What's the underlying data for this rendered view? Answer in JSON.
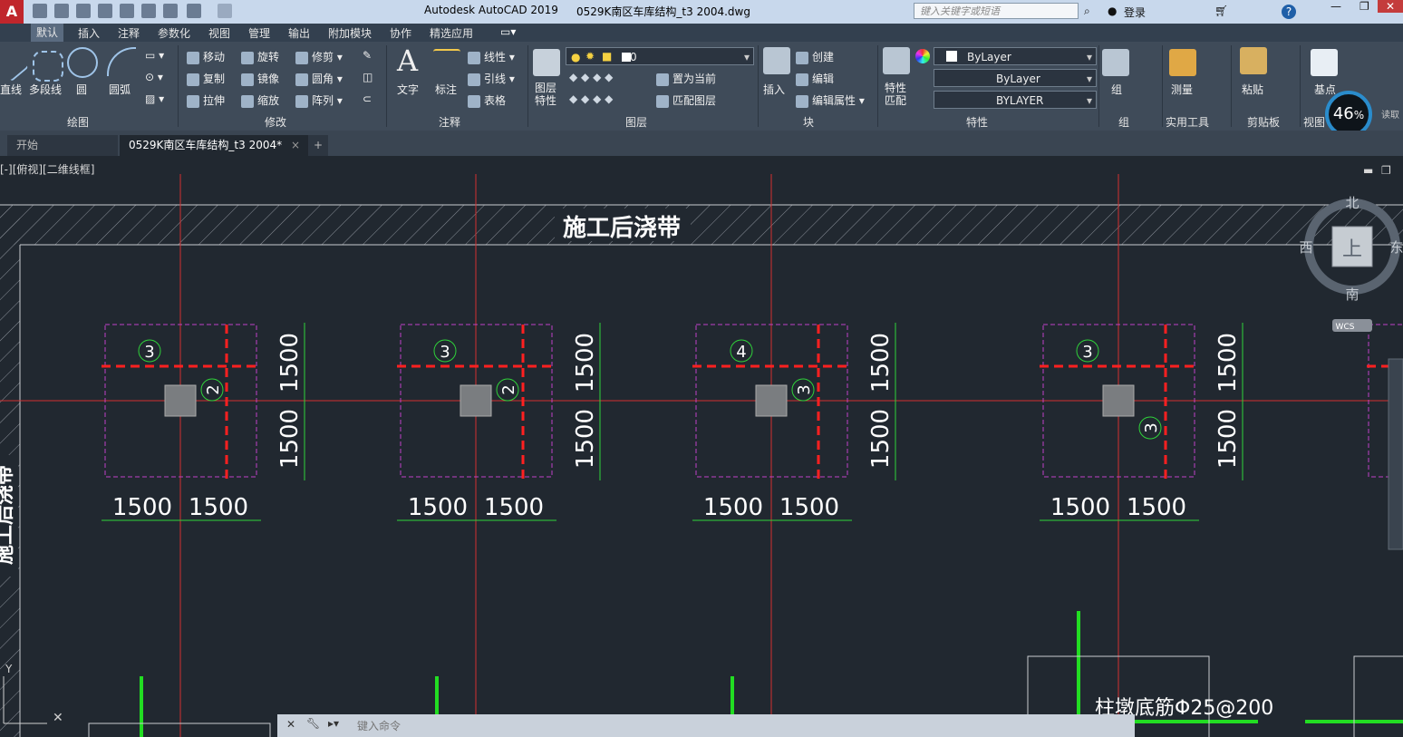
{
  "titlebar": {
    "app_title": "Autodesk AutoCAD 2019",
    "file_title": "0529K南区车库结构_t3 2004.dwg",
    "search_placeholder": "键入关键字或短语",
    "login": "登录",
    "help": "?"
  },
  "ribbon_tabs": [
    "默认",
    "插入",
    "注释",
    "参数化",
    "视图",
    "管理",
    "输出",
    "附加模块",
    "协作",
    "精选应用"
  ],
  "ribbon": {
    "draw": {
      "title": "绘图",
      "line": "直线",
      "polyline": "多段线",
      "circle": "圆",
      "arc": "圆弧"
    },
    "modify": {
      "title": "修改",
      "move": "移动",
      "rotate": "旋转",
      "trim": "修剪",
      "copy": "复制",
      "mirror": "镜像",
      "fillet": "圆角",
      "stretch": "拉伸",
      "scale": "缩放",
      "array": "阵列"
    },
    "annotation": {
      "title": "注释",
      "text": "文字",
      "dimension": "标注",
      "linear": "线性",
      "leader": "引线",
      "table": "表格"
    },
    "layers": {
      "title": "图层",
      "layer_props": "图层特性",
      "current_layer": "0",
      "set_current": "置为当前",
      "match_layer": "匹配图层"
    },
    "block": {
      "title": "块",
      "insert": "插入",
      "create": "创建",
      "edit": "编辑",
      "edit_attr": "编辑属性"
    },
    "properties": {
      "title": "特性",
      "match": "特性匹配",
      "color": "ByLayer",
      "linetype": "ByLayer",
      "lineweight": "BYLAYER"
    },
    "groups": {
      "title": "组",
      "group": "组"
    },
    "utilities": {
      "title": "实用工具",
      "measure": "测量"
    },
    "clipboard": {
      "title": "剪贴板",
      "paste": "粘贴"
    },
    "view": {
      "title": "视图",
      "base": "基点"
    }
  },
  "gauge": {
    "value": "46",
    "unit": "%",
    "side_label": "读取"
  },
  "doc_tabs": {
    "start": "开始",
    "current": "0529K南区车库结构_t3 2004*",
    "close": "×",
    "new": "+"
  },
  "viewport": {
    "label": "[-][俯视][二维线框]"
  },
  "viewcube": {
    "north": "北",
    "south": "南",
    "east": "东",
    "west": "西",
    "top": "上",
    "wcs": "WCS"
  },
  "drawing": {
    "band_label": "施工后浇带",
    "left_band_label": "施工后浇带",
    "bottom_note": "柱墩底筋Φ25@200",
    "ucs_y": "Y",
    "pads": [
      {
        "top_mark": "3",
        "right_mark": "2",
        "dims": [
          "1500",
          "1500",
          "1500",
          "1500"
        ]
      },
      {
        "top_mark": "3",
        "right_mark": "2",
        "dims": [
          "1500",
          "1500",
          "1500",
          "1500"
        ]
      },
      {
        "top_mark": "4",
        "right_mark": "3",
        "dims": [
          "1500",
          "1500",
          "1500",
          "1500"
        ]
      },
      {
        "top_mark": "3",
        "right_mark": "3",
        "dims": [
          "1500",
          "1500",
          "1500",
          "1500"
        ]
      }
    ]
  },
  "command": {
    "placeholder": "键入命令"
  }
}
